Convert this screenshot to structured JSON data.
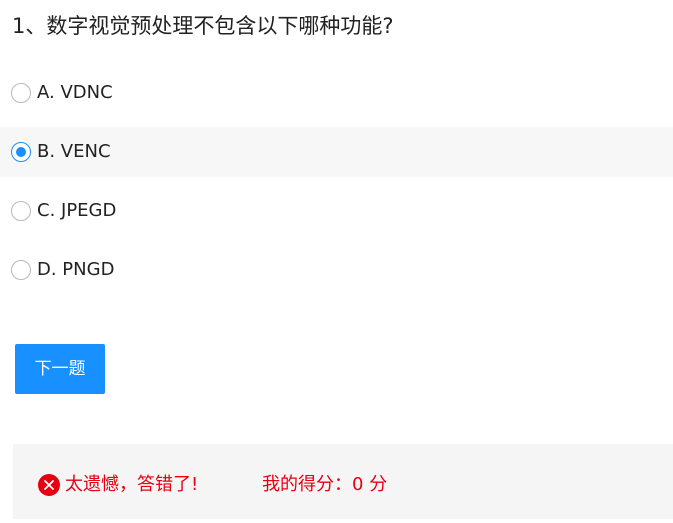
{
  "question": {
    "title": "1、数字视觉预处理不包含以下哪种功能?"
  },
  "options": [
    {
      "label": "A. VDNC",
      "selected": false
    },
    {
      "label": "B. VENC",
      "selected": true
    },
    {
      "label": "C. JPEGD",
      "selected": false
    },
    {
      "label": "D. PNGD",
      "selected": false
    }
  ],
  "next_button": {
    "label": "下一题"
  },
  "result": {
    "icon": "x-circle-icon",
    "message": "太遗憾，答错了!",
    "score_text": "我的得分：0 分",
    "color": "#e60012"
  },
  "colors": {
    "accent": "#1890ff",
    "error": "#e60012",
    "selected_row_bg": "#f7f7f7",
    "result_panel_bg": "#f5f5f5"
  }
}
